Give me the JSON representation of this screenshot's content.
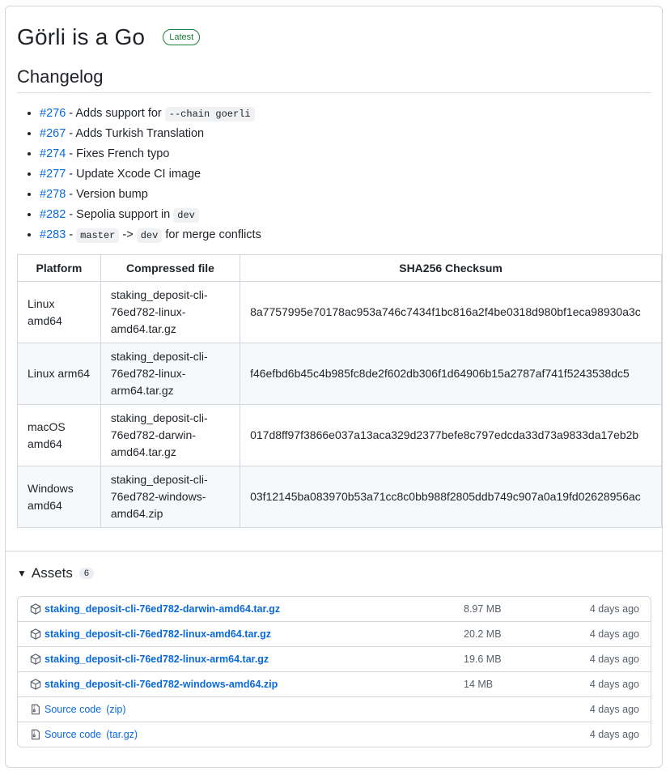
{
  "release": {
    "title": "Görli is a Go",
    "badge": "Latest"
  },
  "changelog": {
    "heading": "Changelog",
    "items": [
      {
        "pr": "#276",
        "text": " - Adds support for ",
        "code": "--chain goerli",
        "text2": "",
        "code2": "",
        "text3": ""
      },
      {
        "pr": "#267",
        "text": " - Adds Turkish Translation",
        "code": "",
        "text2": "",
        "code2": "",
        "text3": ""
      },
      {
        "pr": "#274",
        "text": " - Fixes French typo",
        "code": "",
        "text2": "",
        "code2": "",
        "text3": ""
      },
      {
        "pr": "#277",
        "text": " - Update Xcode CI image",
        "code": "",
        "text2": "",
        "code2": "",
        "text3": ""
      },
      {
        "pr": "#278",
        "text": " - Version bump",
        "code": "",
        "text2": "",
        "code2": "",
        "text3": ""
      },
      {
        "pr": "#282",
        "text": " - Sepolia support in ",
        "code": "dev",
        "text2": "",
        "code2": "",
        "text3": ""
      },
      {
        "pr": "#283",
        "text": " - ",
        "code": "master",
        "text2": " -> ",
        "code2": "dev",
        "text3": " for merge conflicts"
      }
    ]
  },
  "table": {
    "headers": [
      "Platform",
      "Compressed file",
      "SHA256 Checksum"
    ],
    "rows": [
      {
        "platform": "Linux amd64",
        "file": "staking_deposit-cli-76ed782-linux-amd64.tar.gz",
        "sha": "8a7757995e70178ac953a746c7434f1bc816a2f4be0318d980bf1eca98930a3c"
      },
      {
        "platform": "Linux arm64",
        "file": "staking_deposit-cli-76ed782-linux-arm64.tar.gz",
        "sha": "f46efbd6b45c4b985fc8de2f602db306f1d64906b15a2787af741f5243538dc5"
      },
      {
        "platform": "macOS amd64",
        "file": "staking_deposit-cli-76ed782-darwin-amd64.tar.gz",
        "sha": "017d8ff97f3866e037a13aca329d2377befe8c797edcda33d73a9833da17eb2b"
      },
      {
        "platform": "Windows amd64",
        "file": "staking_deposit-cli-76ed782-windows-amd64.zip",
        "sha": "03f12145ba083970b53a71cc8c0bb988f2805ddb749c907a0a19fd02628956ac"
      }
    ]
  },
  "assets": {
    "title": "Assets",
    "count": "6",
    "items": [
      {
        "icon": "package-icon",
        "name": "staking_deposit-cli-76ed782-darwin-amd64.tar.gz",
        "suffix": "",
        "size": "8.97 MB",
        "date": "4 days ago"
      },
      {
        "icon": "package-icon",
        "name": "staking_deposit-cli-76ed782-linux-amd64.tar.gz",
        "suffix": "",
        "size": "20.2 MB",
        "date": "4 days ago"
      },
      {
        "icon": "package-icon",
        "name": "staking_deposit-cli-76ed782-linux-arm64.tar.gz",
        "suffix": "",
        "size": "19.6 MB",
        "date": "4 days ago"
      },
      {
        "icon": "package-icon",
        "name": "staking_deposit-cli-76ed782-windows-amd64.zip",
        "suffix": "",
        "size": "14 MB",
        "date": "4 days ago"
      },
      {
        "icon": "file-zip-icon",
        "name": "Source code",
        "suffix": "(zip)",
        "size": "",
        "date": "4 days ago"
      },
      {
        "icon": "file-zip-icon",
        "name": "Source code",
        "suffix": "(tar.gz)",
        "size": "",
        "date": "4 days ago"
      }
    ]
  },
  "colors": {
    "link": "#0969da",
    "badge_green": "#1a7f37",
    "border": "#d0d7de"
  }
}
